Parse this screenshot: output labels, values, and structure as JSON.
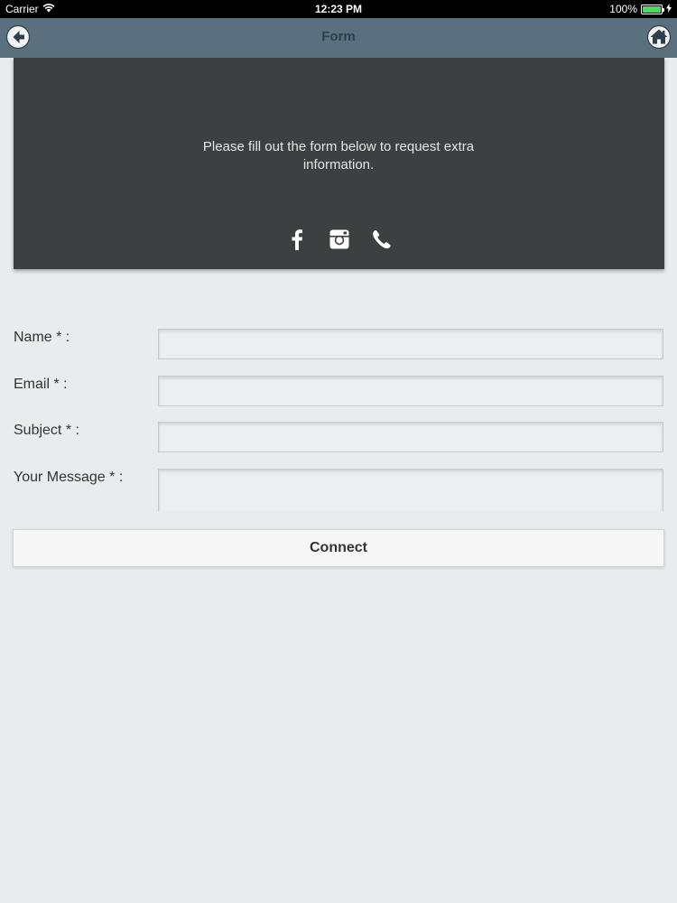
{
  "status_bar": {
    "carrier": "Carrier",
    "time": "12:23 PM",
    "battery": "100%",
    "battery_level": 1.0
  },
  "nav": {
    "title": "Form",
    "back_icon": "back-arrow-icon",
    "home_icon": "home-icon"
  },
  "banner": {
    "text": "Please fill out the form below to request extra information.",
    "icons": [
      "facebook-icon",
      "instagram-icon",
      "phone-icon"
    ]
  },
  "form": {
    "name_label": "Name * :",
    "email_label": "Email * :",
    "subject_label": "Subject * :",
    "message_label": "Your Message * :",
    "name_value": "",
    "email_value": "",
    "subject_value": "",
    "message_value": "",
    "submit_label": "Connect"
  },
  "colors": {
    "nav_bar": "#5b707f",
    "banner": "#3e3f40",
    "background": "#e9ebee",
    "battery": "#4cd964"
  }
}
